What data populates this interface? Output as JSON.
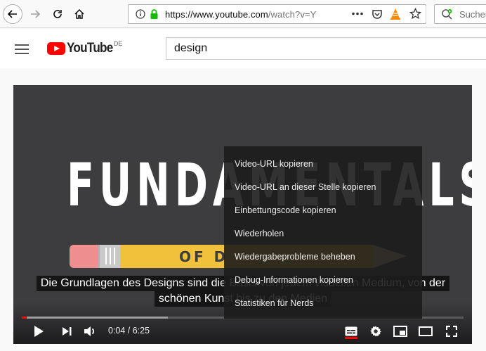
{
  "browser": {
    "url": "https://www.youtube.com/watch?v=Y",
    "url_host": "https://www.youtube.com",
    "url_path": "/watch?v=Y",
    "search_placeholder": "Suchen"
  },
  "youtube": {
    "logo_text": "YouTube",
    "region": "DE",
    "search_value": "design"
  },
  "video": {
    "title_art": "FUNDAMENTALS",
    "subtitle_art": "OF D",
    "captions": [
      "Die Grundlagen des Designs sind die Basis von jedem visuellen Medium, von der",
      "schönen Kunst bis zu den Medien"
    ],
    "time_display": "0:04 / 6:25",
    "progress_played": 0.0104,
    "progress_loaded": 0.33
  },
  "context_menu": {
    "items": [
      "Video-URL kopieren",
      "Video-URL an dieser Stelle kopieren",
      "Einbettungscode kopieren",
      "Wiederholen",
      "Wiedergabeprobleme beheben",
      "Debug-Informationen kopieren",
      "Statistiken für Nerds"
    ]
  },
  "icons": {
    "back": "back-arrow-icon",
    "forward": "forward-arrow-icon",
    "reload": "reload-icon",
    "home": "home-icon",
    "info": "info-icon",
    "lock": "lock-icon",
    "more": "more-dots-icon",
    "pocket": "pocket-icon",
    "vlc": "vlc-icon",
    "bookmark": "bookmark-star-icon",
    "search": "search-icon",
    "hamburger": "hamburger-menu-icon",
    "play": "play-icon",
    "next": "next-icon",
    "volume": "volume-icon",
    "subtitles": "subtitles-icon",
    "settings": "settings-gear-icon",
    "miniplayer": "miniplayer-icon",
    "theater": "theater-mode-icon",
    "fullscreen": "fullscreen-icon"
  },
  "colors": {
    "youtube_red": "#ff0000",
    "lock_green": "#12bc00",
    "player_bg": "#3d3d40",
    "pencil_yellow": "#f2c13b"
  }
}
